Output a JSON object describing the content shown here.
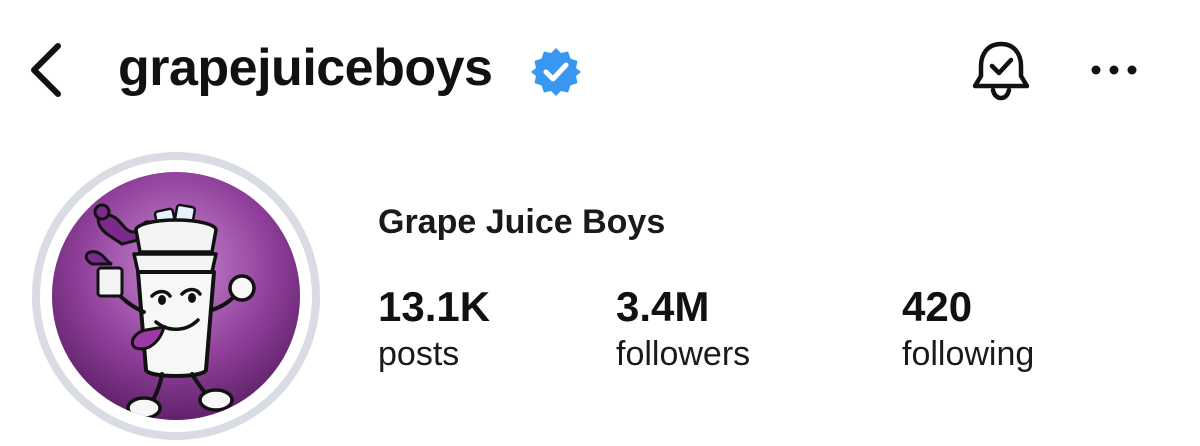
{
  "header": {
    "username": "grapejuiceboys",
    "verified": true,
    "icons": [
      "back-chevron-icon",
      "verified-badge-icon",
      "notification-bell-icon",
      "more-options-icon"
    ],
    "accent_color": "#3897f0"
  },
  "profile": {
    "display_name": "Grape Juice Boys",
    "avatar_icon": "grape-juice-cup-mascot",
    "avatar_colors": [
      "#c98ad0",
      "#5a1f63"
    ]
  },
  "stats": [
    {
      "value": "13.1K",
      "label": "posts"
    },
    {
      "value": "3.4M",
      "label": "followers"
    },
    {
      "value": "420",
      "label": "following"
    }
  ]
}
